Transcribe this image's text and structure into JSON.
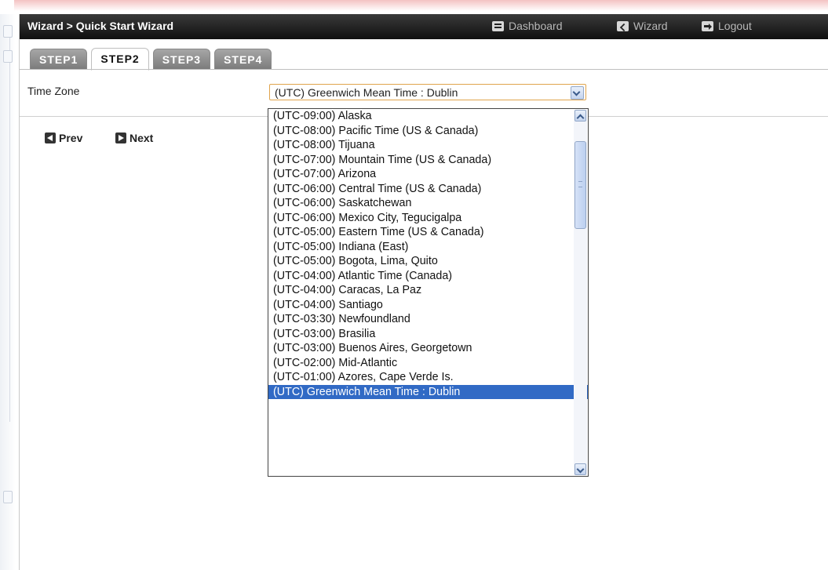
{
  "header": {
    "breadcrumb": "Wizard > Quick Start Wizard",
    "nav": [
      {
        "label": "Dashboard",
        "icon": "dashboard-icon"
      },
      {
        "label": "Wizard",
        "icon": "wizard-icon"
      },
      {
        "label": "Logout",
        "icon": "logout-icon"
      }
    ]
  },
  "tabs": [
    {
      "label": "STEP1",
      "active": false
    },
    {
      "label": "STEP2",
      "active": true
    },
    {
      "label": "STEP3",
      "active": false
    },
    {
      "label": "STEP4",
      "active": false
    }
  ],
  "form": {
    "time_zone_label": "Time Zone",
    "time_zone_value": "(UTC) Greenwich Mean Time : Dublin"
  },
  "buttons": {
    "prev": "Prev",
    "next": "Next"
  },
  "dropdown": {
    "options": [
      "(UTC-09:00) Alaska",
      "(UTC-08:00) Pacific Time (US & Canada)",
      "(UTC-08:00) Tijuana",
      "(UTC-07:00) Mountain Time (US & Canada)",
      "(UTC-07:00) Arizona",
      "(UTC-06:00) Central Time (US & Canada)",
      "(UTC-06:00) Saskatchewan",
      "(UTC-06:00) Mexico City, Tegucigalpa",
      "(UTC-05:00) Eastern Time (US & Canada)",
      "(UTC-05:00) Indiana (East)",
      "(UTC-05:00) Bogota, Lima, Quito",
      "(UTC-04:00) Atlantic Time (Canada)",
      "(UTC-04:00) Caracas, La Paz",
      "(UTC-04:00) Santiago",
      "(UTC-03:30) Newfoundland",
      "(UTC-03:00) Brasilia",
      "(UTC-03:00) Buenos Aires, Georgetown",
      "(UTC-02:00) Mid-Atlantic",
      "(UTC-01:00) Azores, Cape Verde Is.",
      "(UTC) Greenwich Mean Time : Dublin"
    ],
    "selected_index": 19
  },
  "colors": {
    "header_bg": "#1a1a1a",
    "selection": "#316ac5",
    "select_border": "#e0a44c"
  }
}
